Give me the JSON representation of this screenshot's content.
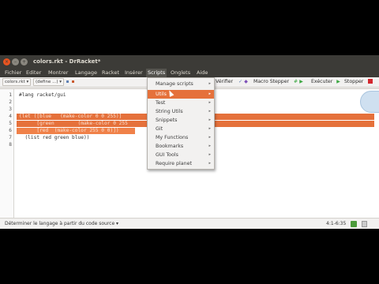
{
  "window": {
    "title": "colors.rkt - DrRacket*"
  },
  "menubar": [
    {
      "label": "Fichier"
    },
    {
      "label": "Editer"
    },
    {
      "label": "Montrer"
    },
    {
      "label": "Langage"
    },
    {
      "label": "Racket"
    },
    {
      "label": "Insérer"
    },
    {
      "label": "Scripts"
    },
    {
      "label": "Onglets"
    },
    {
      "label": "Aide"
    }
  ],
  "toolbar": {
    "file_dropdown": "colors.rkt ▾",
    "define_dropdown": "(define ...) ▾",
    "check_label": "Vérifier",
    "stepper_label": "Macro Stepper",
    "run_label": "Exécuter",
    "stop_label": "Stopper"
  },
  "editor": {
    "lines": [
      {
        "num": "1",
        "text": "#lang racket/gui"
      },
      {
        "num": "2",
        "text": ""
      },
      {
        "num": "3",
        "text": ""
      },
      {
        "num": "4",
        "text": "(let ([blue   (make-color 0 0 255)]"
      },
      {
        "num": "5",
        "text": "      [green        (make-color 0 255"
      },
      {
        "num": "6",
        "text": "      [red  (make-color 255 0 0)])"
      },
      {
        "num": "7",
        "text": "  (list red green blue))"
      },
      {
        "num": "8",
        "text": ""
      }
    ]
  },
  "scripts_menu": {
    "items": [
      {
        "label": "Manage scripts",
        "submenu": "▸"
      },
      {
        "label": "Utils",
        "submenu": "▸"
      },
      {
        "label": "Test",
        "submenu": "▸"
      },
      {
        "label": "String Utils",
        "submenu": "▸"
      },
      {
        "label": "Snippets",
        "submenu": "▸"
      },
      {
        "label": "Git",
        "submenu": "▸"
      },
      {
        "label": "My Functions",
        "submenu": "▸"
      },
      {
        "label": "Bookmarks",
        "submenu": "▸"
      },
      {
        "label": "GUI Tools",
        "submenu": "▸"
      },
      {
        "label": "Require planet",
        "submenu": "▸"
      }
    ]
  },
  "statusbar": {
    "language": "Déterminer le langage à partir du code source ▾",
    "position": "4:1-6:35"
  },
  "colors": {
    "accent": "#e5713b",
    "titlebar": "#3c3b37",
    "run_green": "#3aa640",
    "stop_red": "#d3282e"
  }
}
